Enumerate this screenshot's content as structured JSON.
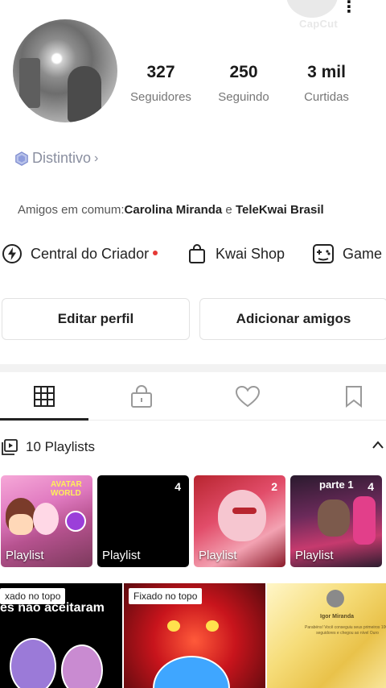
{
  "header": {
    "watermark": "CapCut",
    "menu_glyph": "⋮"
  },
  "profile": {
    "stats": [
      {
        "value": "327",
        "label": "Seguidores"
      },
      {
        "value": "250",
        "label": "Seguindo"
      },
      {
        "value": "3 mil",
        "label": "Curtidas"
      }
    ],
    "badge": {
      "label": "Distintivo",
      "chevron": "›"
    },
    "mutual_friends": {
      "prefix": "Amigos em comum:",
      "friend_1": "Carolina Miranda",
      "conjunction": " e ",
      "friend_2": "TeleKwai Brasil"
    }
  },
  "shortcuts": [
    {
      "label": "Central do Criador",
      "icon": "lightning-circle-icon",
      "has_dot": true
    },
    {
      "label": "Kwai Shop",
      "icon": "shopping-bag-icon"
    },
    {
      "label": "Game",
      "icon": "gamepad-icon"
    }
  ],
  "actions": {
    "edit_profile": "Editar perfil",
    "add_friends": "Adicionar amigos"
  },
  "tabs": [
    {
      "name": "grid-icon",
      "active": true
    },
    {
      "name": "lock-icon",
      "active": false
    },
    {
      "name": "heart-icon",
      "active": false
    },
    {
      "name": "bookmark-icon",
      "active": false
    }
  ],
  "playlists": {
    "title": "10 Playlists",
    "items": [
      {
        "label": "Playlist",
        "count": "",
        "tag": "",
        "art_text": "AVATAR WORLD"
      },
      {
        "label": "Playlist",
        "count": "4",
        "tag": ""
      },
      {
        "label": "Playlist",
        "count": "2",
        "tag": ""
      },
      {
        "label": "Playlist",
        "count": "4",
        "tag": "parte 1"
      }
    ]
  },
  "videos": [
    {
      "pinned_label": "xado no topo",
      "caption": "es nao aceitaram"
    },
    {
      "pinned_label": "Fixado no topo",
      "caption": ""
    },
    {
      "pinned_label": "",
      "name": "Igor Miranda",
      "text": "Parabéns! Você conseguiu seus primeiros 1000 seguidores e chegou ao nível Ouro"
    }
  ],
  "colors": {
    "accent_red": "#e53935",
    "badge_blue": "#8a8fa0"
  }
}
